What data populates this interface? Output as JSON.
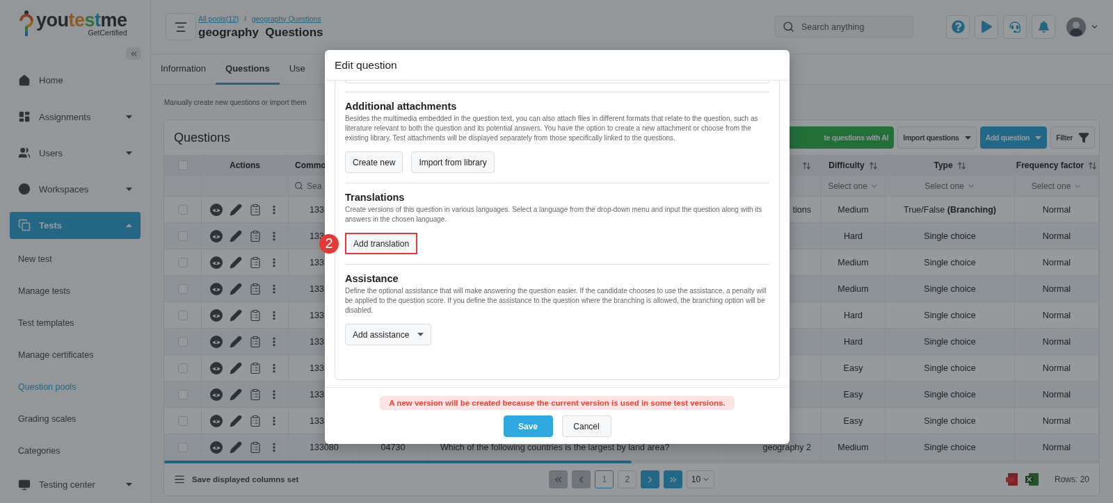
{
  "sidebar": {
    "logo": [
      "you",
      "te",
      "s",
      "t",
      "me"
    ],
    "logo_tagline": "GetCertified",
    "items": [
      {
        "label": "Home",
        "selected": false
      },
      {
        "label": "Assignments",
        "selected": false,
        "expanded": false
      },
      {
        "label": "Users",
        "selected": false,
        "expanded": false
      },
      {
        "label": "Workspaces",
        "selected": false,
        "expanded": false
      },
      {
        "label": "Tests",
        "selected": true,
        "expanded": true,
        "children": [
          {
            "label": "New test",
            "selected": false
          },
          {
            "label": "Manage tests",
            "selected": false
          },
          {
            "label": "Test templates",
            "selected": false
          },
          {
            "label": "Manage certificates",
            "selected": false
          },
          {
            "label": "Question pools",
            "selected": true
          },
          {
            "label": "Grading scales",
            "selected": false
          },
          {
            "label": "Categories",
            "selected": false
          }
        ]
      },
      {
        "label": "Testing center",
        "selected": false,
        "expanded": false
      }
    ]
  },
  "header": {
    "breadcrumbs": [
      {
        "kind": "link",
        "text": "All pools(12)"
      },
      {
        "kind": "separator",
        "text": "/"
      },
      {
        "kind": "link",
        "text": "geography Questions"
      }
    ],
    "title": "geography  Questions",
    "search": {
      "placeholder": "Search anything"
    }
  },
  "tabs": [
    {
      "label": "Information",
      "selected": false
    },
    {
      "label": "Questions",
      "selected": true
    },
    {
      "label": "Use",
      "selected": false
    }
  ],
  "description": "Manually create new questions or import them",
  "questions_panel": {
    "title": "Questions",
    "toolbar": [
      {
        "kind": "ai",
        "label": "te questions with AI"
      },
      {
        "kind": "dropdown",
        "label": "Import questions"
      },
      {
        "kind": "primary",
        "label": "Add question"
      },
      {
        "kind": "filter",
        "label": "Filter"
      }
    ],
    "table": {
      "header_checkbox": {
        "checked": false
      },
      "columns": {
        "actions": {
          "label": "Actions"
        },
        "common": {
          "label": "Commo",
          "filter_placeholder": "Sea"
        },
        "column_6": {
          "sortable": true
        },
        "difficulty": {
          "label": "Difficulty",
          "sortable": true,
          "filter": "Select one"
        },
        "type": {
          "label": "Type",
          "sortable": true,
          "filter": "Select one"
        },
        "frequency": {
          "label": "Frequency factor",
          "sortable": true,
          "filter": "Select one"
        }
      },
      "rows": [
        {
          "checked": false,
          "common": "133",
          "pool": "tions",
          "difficulty": "Medium",
          "type": "True/False **(Branching)**",
          "frequency": "Normal"
        },
        {
          "checked": false,
          "common": "133",
          "difficulty": "Hard",
          "type": "Single choice",
          "frequency": "Normal"
        },
        {
          "checked": false,
          "common": "133",
          "difficulty": "Medium",
          "type": "Single choice",
          "frequency": "Normal"
        },
        {
          "checked": false,
          "common": "133",
          "difficulty": "Medium",
          "type": "Single choice",
          "frequency": "Normal"
        },
        {
          "checked": false,
          "common": "133",
          "difficulty": "Hard",
          "type": "Single choice",
          "frequency": "Normal"
        },
        {
          "checked": false,
          "common": "133",
          "difficulty": "Hard",
          "type": "Single choice",
          "frequency": "Normal"
        },
        {
          "checked": false,
          "common": "133",
          "difficulty": "Easy",
          "type": "Single choice",
          "frequency": "Normal"
        },
        {
          "checked": false,
          "common": "133",
          "difficulty": "Easy",
          "type": "Single choice",
          "frequency": "Normal"
        },
        {
          "checked": false,
          "common": "133",
          "difficulty": "Easy",
          "type": "Single choice",
          "frequency": "Normal"
        },
        {
          "checked": false,
          "common": "133080",
          "column_4": "04730",
          "question": "Which of the following countries is the largest by land area?",
          "pool": "geography 2",
          "difficulty": "Medium",
          "type": "Single choice",
          "frequency": "Normal"
        }
      ]
    },
    "footer": {
      "save_columns": "Save displayed columns set",
      "pagination": [
        {
          "kind": "first",
          "disabled": true
        },
        {
          "kind": "prev",
          "disabled": true
        },
        {
          "kind": "page",
          "label": "1",
          "selected": true
        },
        {
          "kind": "page",
          "label": "2",
          "selected": false
        },
        {
          "kind": "next",
          "disabled": false
        },
        {
          "kind": "last",
          "disabled": false
        }
      ],
      "page_size": "10",
      "rows_total": "Rows: 20"
    }
  },
  "modal": {
    "title": "Edit question",
    "sections": [
      {
        "title": "Additional attachments",
        "description": "Besides the multimedia embedded in the question text, you can also attach files in different formats that relate to the question, such as literature relevant to both the question and its potential answers. You have the option to create a new attachment or choose from the existing library. Test attachments will be displayed separately from those specifically linked to the questions.",
        "actions": [
          {
            "kind": "button",
            "label": "Create new",
            "highlighted": false
          },
          {
            "kind": "button",
            "label": "Import from library",
            "highlighted": false
          }
        ]
      },
      {
        "title": "Translations",
        "description": "Create versions of this question in various languages. Select a language from the drop-down menu and input the question along with its answers in the chosen language.",
        "actions": [
          {
            "kind": "button",
            "label": "Add translation",
            "highlighted": true,
            "marker": "2"
          }
        ]
      },
      {
        "title": "Assistance",
        "description": "Define the optional assistance that will make answering the question easier. If the candidate chooses to use the assistance, a penalty will be applied to the question score. If you define the assistance to the question where the branching is allowed, the branching option will be disabled.",
        "actions": [
          {
            "kind": "dropdown",
            "label": "Add assistance",
            "highlighted": false
          }
        ]
      }
    ],
    "warning": "A new version will be created because the current version is used in some test versions.",
    "buttons": [
      {
        "kind": "primary",
        "label": "Save"
      },
      {
        "kind": "secondary",
        "label": "Cancel"
      }
    ]
  }
}
